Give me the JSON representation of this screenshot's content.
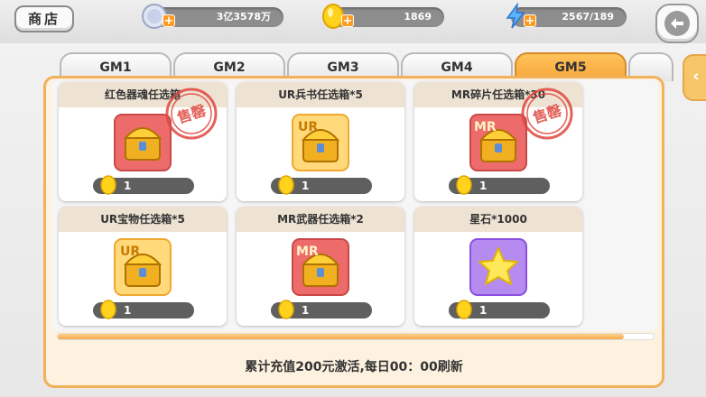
{
  "topbar": {
    "shop_label": "商店",
    "resources": [
      {
        "icon": "silver-coin-icon",
        "value": "3亿3578万"
      },
      {
        "icon": "gold-coin-icon",
        "value": "1869"
      },
      {
        "icon": "lightning-energy-icon",
        "value": "2567/189"
      }
    ]
  },
  "tabs": [
    {
      "label": "GM1",
      "active": false
    },
    {
      "label": "GM2",
      "active": false
    },
    {
      "label": "GM3",
      "active": false
    },
    {
      "label": "GM4",
      "active": false
    },
    {
      "label": "GM5",
      "active": true
    }
  ],
  "items": [
    {
      "name": "红色器魂任选箱",
      "price": "1",
      "icon": "red-chest-icon",
      "sold_out": true,
      "stamp": "售罄"
    },
    {
      "name": "UR兵书任选箱*5",
      "price": "1",
      "icon": "ur-chest-icon",
      "sold_out": false
    },
    {
      "name": "MR碎片任选箱*30",
      "price": "1",
      "icon": "mr-chest-icon",
      "sold_out": true,
      "stamp": "售罄"
    },
    {
      "name": "UR宝物任选箱*5",
      "price": "1",
      "icon": "ur-chest-icon",
      "sold_out": false
    },
    {
      "name": "MR武器任选箱*2",
      "price": "1",
      "icon": "mr-chest-icon",
      "sold_out": false
    },
    {
      "name": "星石*1000",
      "price": "1",
      "icon": "yellow-star-stone-icon",
      "sold_out": false
    }
  ],
  "scroll_progress": 0.95,
  "footer_text": "累计充值200元激活,每日00：00刷新",
  "colors": {
    "accent": "#f5a63a",
    "panel": "#fdf1df"
  }
}
